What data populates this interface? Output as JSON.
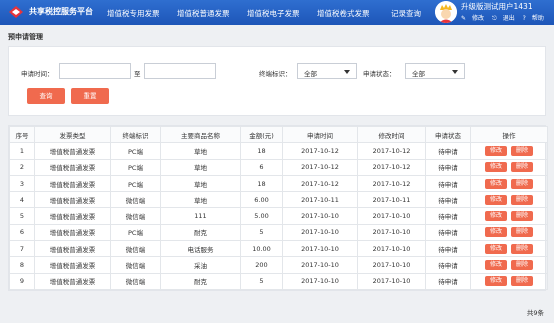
{
  "header": {
    "brand": "共享税控服务平台",
    "nav": [
      "增值税专用发票",
      "增值税普通发票",
      "增值税电子发票",
      "增值税卷式发票",
      "记录查询"
    ],
    "user_name": "升级版测试用户1431",
    "links": {
      "modify": "修改",
      "logout": "退出",
      "help": "帮助"
    }
  },
  "page_title": "预申请管理",
  "filters": {
    "apply_time_label": "申请时间：",
    "to_label": "至",
    "terminal_label": "终端标识：",
    "terminal_value": "全部",
    "status_label": "申请状态：",
    "status_value": "全部",
    "query_button": "查询",
    "reset_button": "重置"
  },
  "table": {
    "headers": [
      "序号",
      "发票类型",
      "终端标识",
      "主要商品名称",
      "金额(元)",
      "申请时间",
      "修改时间",
      "申请状态",
      "操作"
    ],
    "action_edit": "修改",
    "action_delete": "删除",
    "rows": [
      [
        "1",
        "增值税普通发票",
        "PC端",
        "草地",
        "18",
        "2017-10-12",
        "2017-10-12",
        "待申请"
      ],
      [
        "2",
        "增值税普通发票",
        "PC端",
        "草地",
        "6",
        "2017-10-12",
        "2017-10-12",
        "待申请"
      ],
      [
        "3",
        "增值税普通发票",
        "PC端",
        "草地",
        "18",
        "2017-10-12",
        "2017-10-12",
        "待申请"
      ],
      [
        "4",
        "增值税普通发票",
        "微信端",
        "草地",
        "6.00",
        "2017-10-11",
        "2017-10-11",
        "待申请"
      ],
      [
        "5",
        "增值税普通发票",
        "微信端",
        "111",
        "5.00",
        "2017-10-10",
        "2017-10-10",
        "待申请"
      ],
      [
        "6",
        "增值税普通发票",
        "PC端",
        "耐克",
        "5",
        "2017-10-10",
        "2017-10-10",
        "待申请"
      ],
      [
        "7",
        "增值税普通发票",
        "微信端",
        "电话服务",
        "10.00",
        "2017-10-10",
        "2017-10-10",
        "待申请"
      ],
      [
        "8",
        "增值税普通发票",
        "微信端",
        "采油",
        "200",
        "2017-10-10",
        "2017-10-10",
        "待申请"
      ],
      [
        "9",
        "增值税普通发票",
        "微信端",
        "耐克",
        "5",
        "2017-10-10",
        "2017-10-10",
        "待申请"
      ]
    ]
  },
  "footer_count": "共9条",
  "colors": {
    "header_blue": "#1d56b8",
    "action_red": "#f06a4e"
  },
  "icons": {
    "logo": "brand-logo-icon",
    "avatar": "user-avatar-icon",
    "modify": "edit-icon",
    "logout": "logout-icon",
    "help": "help-icon"
  }
}
